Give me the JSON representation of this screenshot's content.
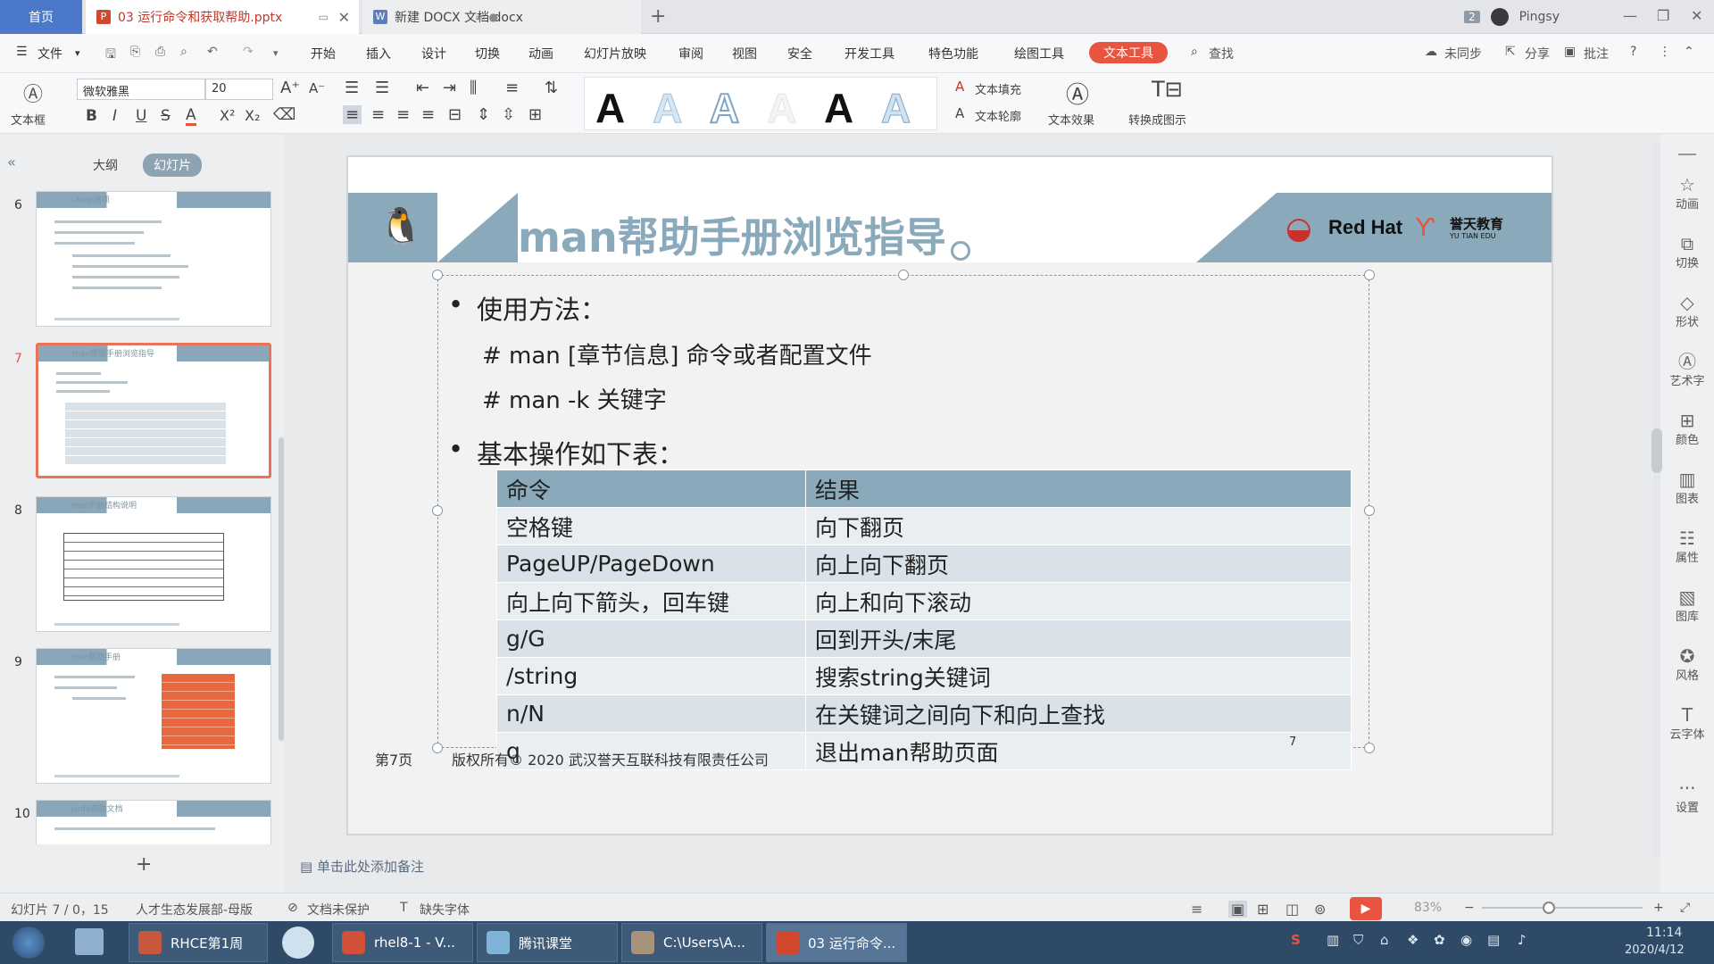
{
  "tabs": {
    "home": "首页",
    "doc1": "03 运行命令和获取帮助.pptx",
    "doc1_icon": "P",
    "doc2": "新建 DOCX 文档.docx",
    "doc2_icon": "W"
  },
  "user": {
    "badge": "2",
    "name": "Pingsy"
  },
  "menu": {
    "file": "文件",
    "items": [
      "开始",
      "插入",
      "设计",
      "切换",
      "动画",
      "幻灯片放映",
      "审阅",
      "视图",
      "安全",
      "开发工具",
      "特色功能",
      "绘图工具"
    ],
    "active": "文本工具",
    "search": "查找",
    "sync": "未同步",
    "share": "分享",
    "comment": "批注"
  },
  "ribbon": {
    "textbox": "文本框",
    "font_name": "微软雅黑",
    "font_size": "20",
    "style_letter": "A",
    "text_fill": "文本填充",
    "text_outline": "文本轮廓",
    "text_effect": "文本效果",
    "convert": "转换成图示"
  },
  "panel": {
    "outline_tab": "大纲",
    "slides_tab": "幻灯片",
    "thumbs": [
      {
        "num": "6",
        "title": "--help选项"
      },
      {
        "num": "7",
        "title": "man帮助手册浏览指导"
      },
      {
        "num": "8",
        "title": "man手册结构说明"
      },
      {
        "num": "9",
        "title": "man帮助手册"
      },
      {
        "num": "10",
        "title": "pinfo帮助文档"
      }
    ],
    "add": "+"
  },
  "slide": {
    "title": "man帮助手册浏览指导",
    "brand": "Red Hat",
    "brand2": "誉天教育",
    "brand2_sub": "YU TIAN EDU",
    "bullet1": "使用方法：",
    "code1": "# man [章节信息]  命令或者配置文件",
    "code2": "# man -k 关键字",
    "bullet2": "基本操作如下表：",
    "table": {
      "headers": [
        "命令",
        "结果"
      ],
      "rows": [
        [
          "空格键",
          "向下翻页"
        ],
        [
          "PageUP/PageDown",
          "向上向下翻页"
        ],
        [
          "向上向下箭头，回车键",
          "向上和向下滚动"
        ],
        [
          "g/G",
          "回到开头/末尾"
        ],
        [
          "/string",
          "搜索string关键词"
        ],
        [
          "n/N",
          "在关键词之间向下和向上查找"
        ],
        [
          "q",
          "退出man帮助页面"
        ]
      ]
    },
    "page_label": "第7页",
    "copyright": "版权所有© 2020 武汉誉天互联科技有限责任公司",
    "page_num": "7"
  },
  "rightbar": [
    "动画",
    "切换",
    "形状",
    "艺术字",
    "颜色",
    "图表",
    "属性",
    "图库",
    "风格",
    "云字体",
    "设置"
  ],
  "notes": "单击此处添加备注",
  "status": {
    "slide_pos": "幻灯片 7 / 0，15",
    "template": "人才生态发展部-母版",
    "protect": "文档未保护",
    "font_missing": "缺失字体",
    "zoom": "83%"
  },
  "taskbar": {
    "items": [
      "RHCE第1周",
      "rhel8-1 - V...",
      "腾讯课堂",
      "C:\\Users\\A...",
      "03 运行命令..."
    ],
    "time": "11:14",
    "date": "2020/4/12"
  },
  "colors": {
    "accent": "#e8543f",
    "header_blue": "#8aa9ba",
    "home_tab": "#4b78c9"
  }
}
